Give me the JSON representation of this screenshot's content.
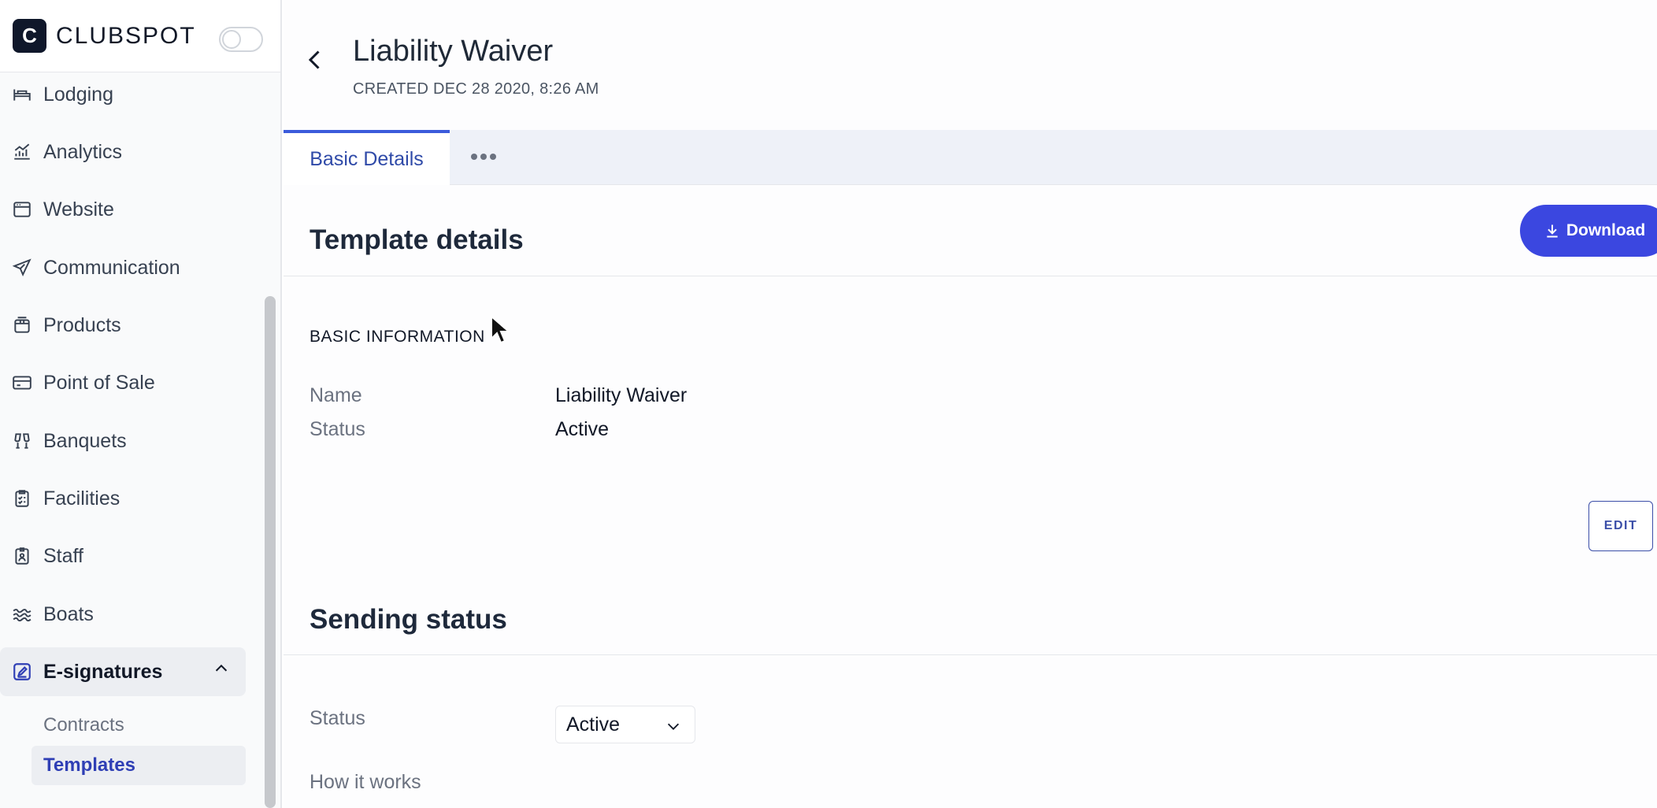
{
  "brand": {
    "logo_letter": "C",
    "name": "CLUBSPOT"
  },
  "sidebar": {
    "items": [
      {
        "label": "Lodging",
        "icon": "bed-icon"
      },
      {
        "label": "Analytics",
        "icon": "chart-icon"
      },
      {
        "label": "Website",
        "icon": "browser-icon"
      },
      {
        "label": "Communication",
        "icon": "send-icon"
      },
      {
        "label": "Products",
        "icon": "package-icon"
      },
      {
        "label": "Point of Sale",
        "icon": "card-icon"
      },
      {
        "label": "Banquets",
        "icon": "glasses-icon"
      },
      {
        "label": "Facilities",
        "icon": "clipboard-icon"
      },
      {
        "label": "Staff",
        "icon": "badge-icon"
      },
      {
        "label": "Boats",
        "icon": "waves-icon"
      },
      {
        "label": "E-signatures",
        "icon": "signature-icon"
      }
    ],
    "sub_items": [
      {
        "label": "Contracts"
      },
      {
        "label": "Templates"
      }
    ]
  },
  "header": {
    "title": "Liability Waiver",
    "subtitle": "CREATED DEC 28 2020, 8:26 AM"
  },
  "tabs": [
    {
      "label": "Basic Details"
    }
  ],
  "template_details": {
    "title": "Template details",
    "download_label": "Download",
    "basic_info_heading": "BASIC INFORMATION",
    "fields": [
      {
        "label": "Name",
        "value": "Liability Waiver"
      },
      {
        "label": "Status",
        "value": "Active"
      }
    ],
    "edit_label": "EDIT"
  },
  "sending_status": {
    "title": "Sending status",
    "status_label": "Status",
    "status_value": "Active",
    "how_it_works_label": "How it works"
  },
  "colors": {
    "accent": "#3b47e0",
    "active_link": "#2f3fb5",
    "brand_dark": "#0f172a"
  }
}
